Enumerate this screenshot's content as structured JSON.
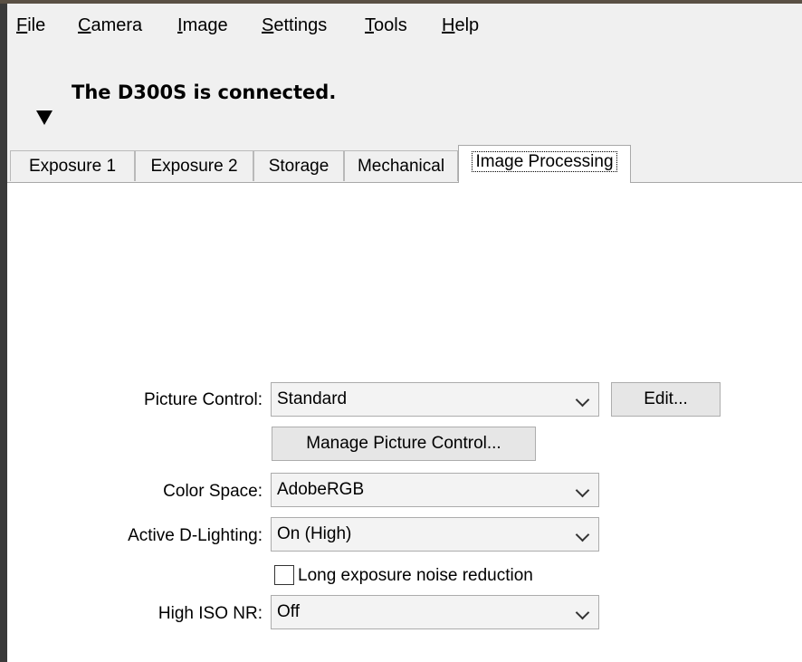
{
  "menu": {
    "items": [
      {
        "mnemonic": "F",
        "rest": "ile"
      },
      {
        "mnemonic": "C",
        "rest": "amera"
      },
      {
        "mnemonic": "I",
        "rest": "mage"
      },
      {
        "mnemonic": "S",
        "rest": "ettings"
      },
      {
        "mnemonic": "T",
        "rest": "ools"
      },
      {
        "mnemonic": "H",
        "rest": "elp"
      }
    ]
  },
  "status": {
    "text": "The D300S is connected.",
    "toggle_icon": "triangle-down-icon"
  },
  "tabs": [
    {
      "label": "Exposure 1"
    },
    {
      "label": "Exposure 2"
    },
    {
      "label": "Storage"
    },
    {
      "label": "Mechanical"
    },
    {
      "label": "Image Processing",
      "active": true
    }
  ],
  "image_processing": {
    "picture_control": {
      "label": "Picture Control:",
      "value": "Standard"
    },
    "edit_button": "Edit...",
    "manage_button": "Manage Picture Control...",
    "color_space": {
      "label": "Color Space:",
      "value": "AdobeRGB"
    },
    "active_d_lighting": {
      "label": "Active D-Lighting:",
      "value": "On (High)"
    },
    "long_exposure_nr": {
      "label": "Long exposure noise reduction",
      "checked": false
    },
    "high_iso_nr": {
      "label": "High ISO NR:",
      "value": "Off"
    }
  }
}
